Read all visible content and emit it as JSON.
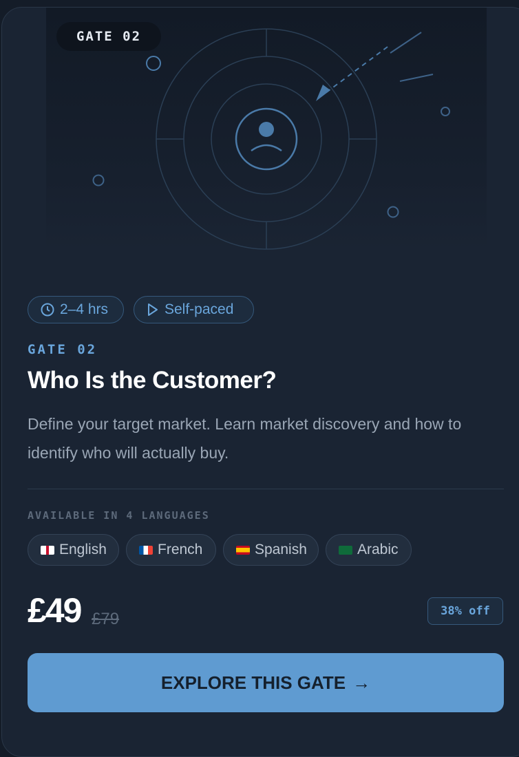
{
  "hero": {
    "badge": "GATE 02",
    "illustration_icon": "user-target-icon"
  },
  "meta": {
    "duration": "2–4 hrs",
    "duration_icon": "clock-icon",
    "pace": "Self-paced",
    "pace_icon": "play-icon"
  },
  "course": {
    "eyebrow": "GATE 02",
    "title": "Who Is the Customer?",
    "description": "Define your target market. Learn market discovery and how to identify who will actually buy."
  },
  "languages": {
    "heading": "AVAILABLE IN 4 LANGUAGES",
    "items": [
      {
        "label": "English",
        "flag": "uk-flag-icon"
      },
      {
        "label": "French",
        "flag": "france-flag-icon"
      },
      {
        "label": "Spanish",
        "flag": "spain-flag-icon"
      },
      {
        "label": "Arabic",
        "flag": "saudi-flag-icon"
      }
    ]
  },
  "pricing": {
    "price": "£49",
    "original_price": "£79",
    "discount": "38% off"
  },
  "cta": {
    "label": "EXPLORE THIS GATE",
    "arrow": "→"
  },
  "colors": {
    "accent": "#6aa6dc",
    "cta_background": "#5f9bd1",
    "card_background": "#1a2433"
  }
}
